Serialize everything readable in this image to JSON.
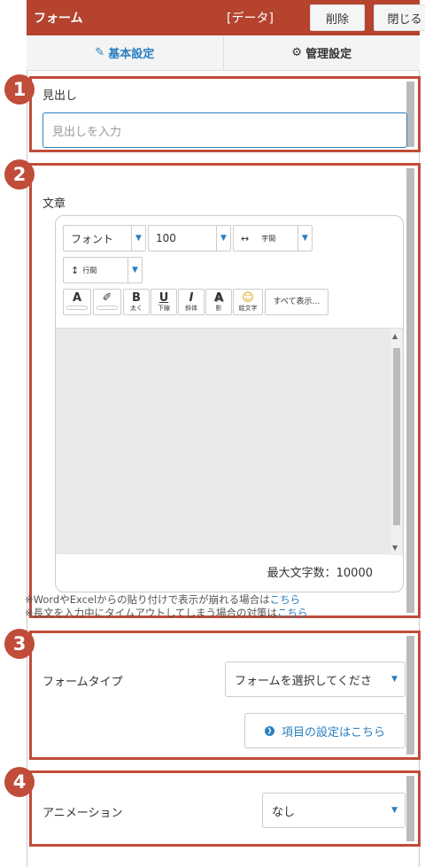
{
  "header": {
    "title": "フォーム",
    "tag": "[データ]",
    "delete_label": "削除",
    "close_label": "閉じる"
  },
  "tabs": [
    {
      "label": "基本設定",
      "icon": "edit-icon",
      "active": true
    },
    {
      "label": "管理設定",
      "icon": "gear-icon",
      "active": false
    }
  ],
  "badges": [
    "1",
    "2",
    "3",
    "4"
  ],
  "heading": {
    "label": "見出し",
    "placeholder": "見出しを入力"
  },
  "body_text": {
    "label": "文章",
    "toolbar": {
      "font": "フォント",
      "size": "100",
      "letter_spacing_icon": "↔",
      "letter_spacing": "字間",
      "line_height_icon": "↕",
      "line_height": "行間",
      "buttons": [
        {
          "glyph": "A",
          "sub": ""
        },
        {
          "glyph": "✐",
          "sub": ""
        },
        {
          "glyph": "B",
          "sub": "太く"
        },
        {
          "glyph": "U",
          "sub": "下線"
        },
        {
          "glyph": "I",
          "sub": "斜体"
        },
        {
          "glyph": "A",
          "sub": "影"
        },
        {
          "glyph": "☺",
          "sub": "絵文字"
        }
      ],
      "show_all": "すべて表示…"
    },
    "max_chars": "最大文字数：10000",
    "note1_text": "※WordやExcelからの貼り付けで表示が崩れる場合は",
    "note1_link": "こちら",
    "note2_text": "※長文を入力中にタイムアウトしてしまう場合の対策は",
    "note2_link": "こちら"
  },
  "form_type": {
    "label": "フォームタイプ",
    "select_value": "フォームを選択してくださ",
    "item_settings": "項目の設定はこちら"
  },
  "animation": {
    "label": "アニメーション",
    "select_value": "なし"
  },
  "colors": {
    "header": "#b5432e",
    "accent_blue": "#2a7fc1",
    "highlight_red": "#c04c3a"
  }
}
